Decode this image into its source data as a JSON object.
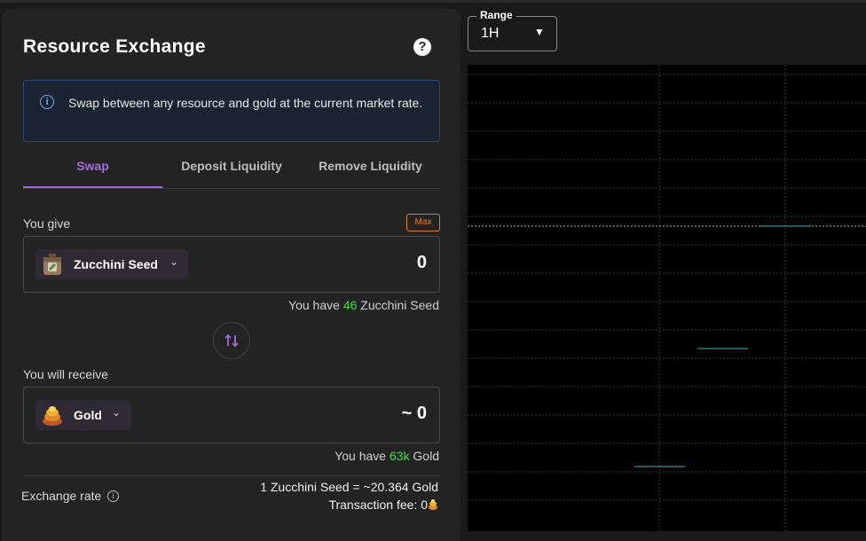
{
  "panel": {
    "title": "Resource Exchange",
    "help_icon": "?",
    "info_icon": "i",
    "info_text": "Swap between any resource and gold at the current market rate.",
    "tabs": [
      {
        "label": "Swap",
        "active": true
      },
      {
        "label": "Deposit Liquidity",
        "active": false
      },
      {
        "label": "Remove Liquidity",
        "active": false
      }
    ],
    "give": {
      "label": "You give",
      "max_label": "Max",
      "resource": "Zucchini Seed",
      "amount": "0",
      "have_prefix": "You have",
      "have_value": "46",
      "have_suffix": "Zucchini Seed"
    },
    "receive": {
      "label": "You will receive",
      "resource": "Gold",
      "amount": "~ 0",
      "have_prefix": "You have",
      "have_value": "63k",
      "have_suffix": "Gold"
    },
    "exchange_rate_label": "Exchange rate",
    "exchange_rate_value": "1 Zucchini Seed = ~20.364 Gold",
    "fee_label": "Transaction fee: 0"
  },
  "range": {
    "label": "Range",
    "value": "1H"
  },
  "colors": {
    "accent": "#a46bdf",
    "positive": "#4cd64c",
    "warning": "#e07a2e",
    "info_border": "#2f4a72",
    "chart_line": "#3fb8c0"
  }
}
